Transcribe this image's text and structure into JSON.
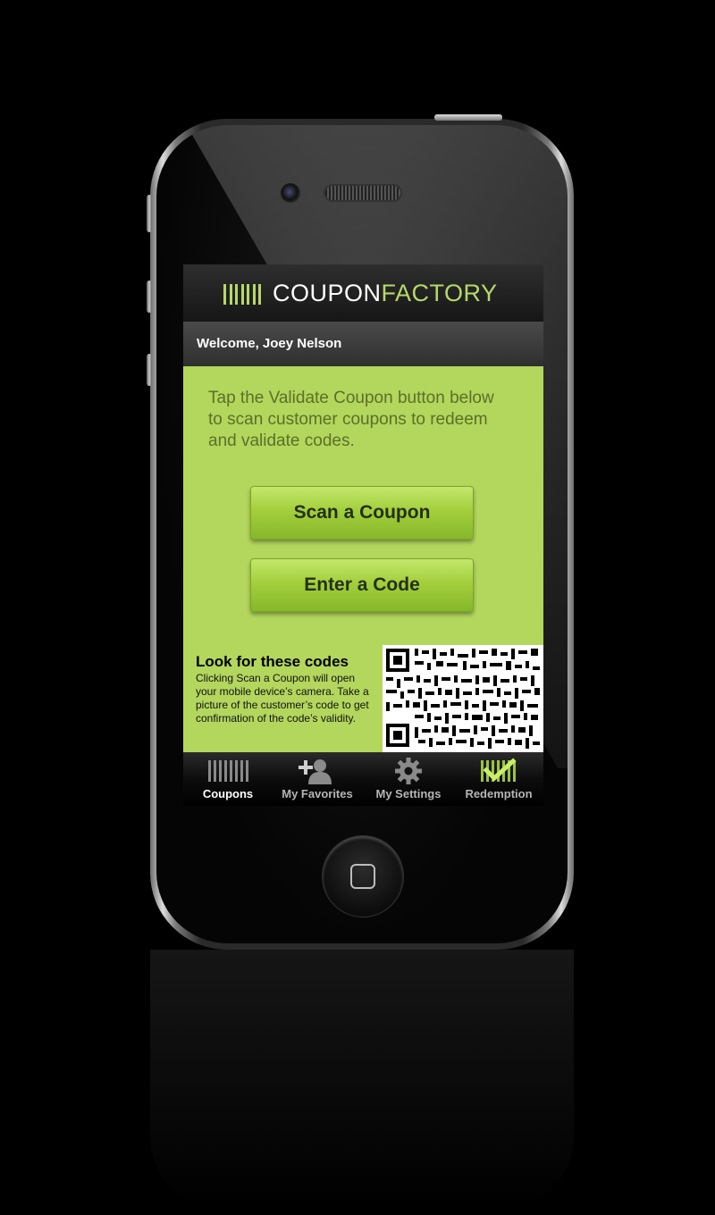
{
  "header": {
    "logo_text_left": "COUPON",
    "logo_text_right": "FACTORY"
  },
  "welcome": {
    "text": "Welcome, Joey Nelson"
  },
  "main": {
    "instruction": "Tap the Validate Coupon button below to scan customer coupons to redeem and validate codes.",
    "scan_button_label": "Scan a Coupon",
    "enter_code_button_label": "Enter a Code",
    "codes_title": "Look for these codes",
    "codes_description": "Clicking Scan a Coupon will open your mobile device’s camera. Take a picture of the customer’s code to get confirmation of the code’s validity."
  },
  "tabbar": {
    "items": [
      {
        "label": "Coupons",
        "icon": "barcode-icon",
        "active": true
      },
      {
        "label": "My Favorites",
        "icon": "add-person-icon",
        "active": false
      },
      {
        "label": "My Settings",
        "icon": "gear-icon",
        "active": false
      },
      {
        "label": "Redemption",
        "icon": "barcode-check-icon",
        "active": false
      }
    ]
  },
  "colors": {
    "accent_green": "#b3d65d",
    "logo_green": "#b5d86a",
    "background": "#000000"
  }
}
